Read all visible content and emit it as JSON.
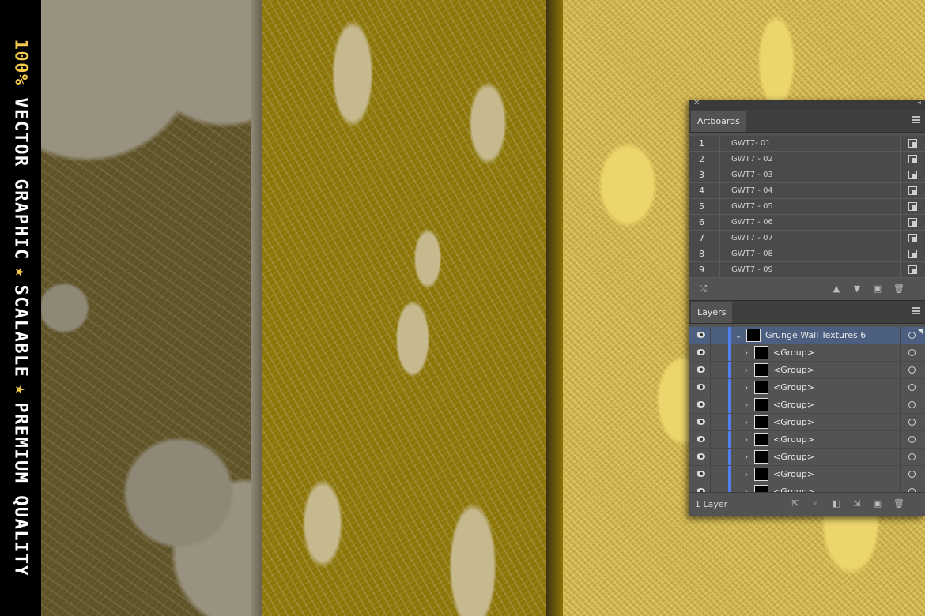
{
  "banner": {
    "part1_highlight": "100%",
    "part1_rest": " VECTOR GRAPHIC",
    "separator": "★",
    "part2": "SCALABLE",
    "part3": "PREMIUM QUALITY"
  },
  "colors": {
    "strip1": "#5f5427",
    "strip2": "#8c7608",
    "strip3": "#c4a94a",
    "layer_color_bar": "#4f7ff0"
  },
  "artboards_panel": {
    "tab_label": "Artboards",
    "items": [
      {
        "num": "1",
        "name": "GWT7- 01"
      },
      {
        "num": "2",
        "name": "GWT7 - 02"
      },
      {
        "num": "3",
        "name": "GWT7 - 03"
      },
      {
        "num": "4",
        "name": "GWT7 - 04"
      },
      {
        "num": "5",
        "name": "GWT7 - 05"
      },
      {
        "num": "6",
        "name": "GWT7 - 06"
      },
      {
        "num": "7",
        "name": "GWT7 - 07"
      },
      {
        "num": "8",
        "name": "GWT7 - 08"
      },
      {
        "num": "9",
        "name": "GWT7 - 09"
      }
    ]
  },
  "layers_panel": {
    "tab_label": "Layers",
    "parent_layer": "Grunge Wall Textures 6",
    "groups": [
      "<Group>",
      "<Group>",
      "<Group>",
      "<Group>",
      "<Group>",
      "<Group>",
      "<Group>",
      "<Group>",
      "<Group>"
    ],
    "layer_count": "1 Layer"
  }
}
